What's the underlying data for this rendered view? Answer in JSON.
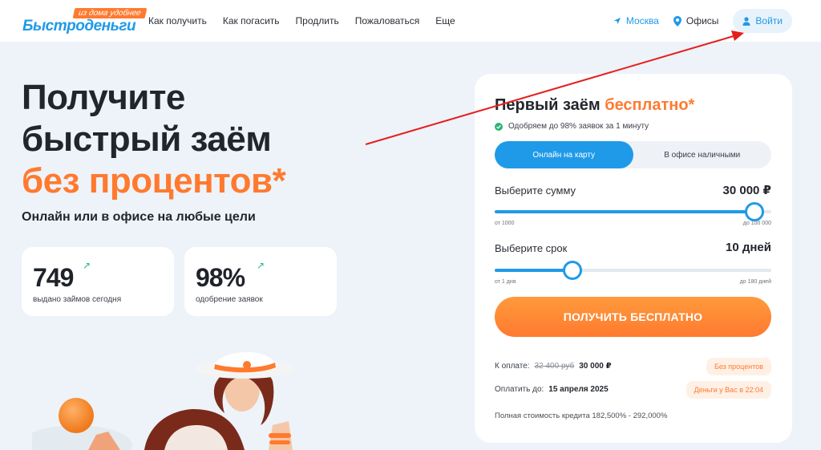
{
  "header": {
    "logo_tag": "из дома удобнее",
    "logo_text": "Быстроденьги",
    "nav": [
      "Как получить",
      "Как погасить",
      "Продлить",
      "Пожаловаться",
      "Еще"
    ],
    "city": "Москва",
    "offices": "Офисы",
    "login": "Войти"
  },
  "hero": {
    "title_line1": "Получите",
    "title_line2": "быстрый заём",
    "title_line3": "без процентов*",
    "subtitle": "Онлайн или в офисе на любые цели",
    "stats": [
      {
        "value": "749",
        "label": "выдано займов сегодня"
      },
      {
        "value": "98%",
        "label": "одобрение заявок"
      }
    ]
  },
  "card": {
    "title_main": "Первый заём ",
    "title_accent": "бесплатно*",
    "approve_text": "Одобряем до 98% заявок за 1 минуту",
    "tabs": [
      "Онлайн на карту",
      "В офисе наличными"
    ],
    "amount": {
      "label": "Выберите сумму",
      "value": "30 000 ₽",
      "min_label": "от 1000",
      "max_label": "до 100 000",
      "fraction": 0.94
    },
    "term": {
      "label": "Выберите срок",
      "value": "10 дней",
      "min_label": "от 1 дня",
      "max_label": "до 180 дней",
      "fraction": 0.28
    },
    "cta": "ПОЛУЧИТЬ БЕСПЛАТНО",
    "pay_label": "К оплате:",
    "pay_old": "32 400 руб",
    "pay_new": "30 000 ₽",
    "pay_badge": "Без процентов",
    "due_label": "Оплатить до:",
    "due_date": "15 апреля 2025",
    "due_badge": "Деньги у Вас в 22:04",
    "full_cost": "Полная стоимость кредита 182,500% - 292,000%"
  },
  "colors": {
    "brand_blue": "#1f9ae8",
    "accent_orange": "#ff7a2f",
    "annotation_red": "#e61e1e"
  }
}
